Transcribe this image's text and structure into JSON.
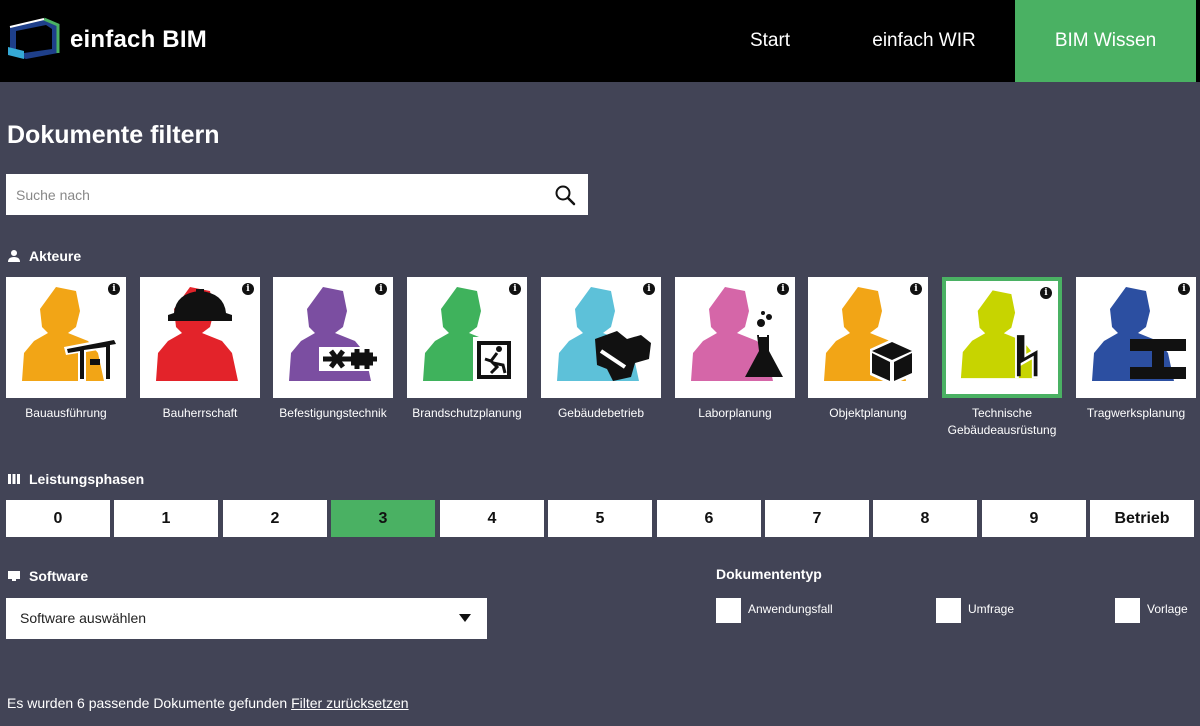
{
  "header": {
    "brand": "einfach BIM",
    "nav": [
      {
        "label": "Start"
      },
      {
        "label": "einfach WIR"
      },
      {
        "label": "BIM Wissen",
        "active": true
      }
    ]
  },
  "page_title": "Dokumente filtern",
  "search": {
    "placeholder": "Suche nach",
    "value": ""
  },
  "actors": {
    "heading": "Akteure",
    "items": [
      {
        "label": "Bauausführung",
        "color": "#f2a516",
        "icon": "crane-icon"
      },
      {
        "label": "Bauherrschaft",
        "color": "#e3232a",
        "icon": "hardhat-icon"
      },
      {
        "label": "Befestigungstechnik",
        "color": "#7b4ea1",
        "icon": "fastener-icon"
      },
      {
        "label": "Brandschutzplanung",
        "color": "#3fb25c",
        "icon": "emergency-exit-icon"
      },
      {
        "label": "Gebäudebetrieb",
        "color": "#5dc1d9",
        "icon": "wrench-icon"
      },
      {
        "label": "Laborplanung",
        "color": "#d566a8",
        "icon": "flask-icon"
      },
      {
        "label": "Objektplanung",
        "color": "#f2a516",
        "icon": "cube-icon"
      },
      {
        "label": "Technische Gebäudeausrüstung",
        "color": "#c7d400",
        "icon": "lightning-icon",
        "selected": true
      },
      {
        "label": "Tragwerksplanung",
        "color": "#2c4fa1",
        "icon": "i-beam-icon"
      }
    ]
  },
  "phases": {
    "heading": "Leistungsphasen",
    "items": [
      "0",
      "1",
      "2",
      "3",
      "4",
      "5",
      "6",
      "7",
      "8",
      "9",
      "Betrieb"
    ],
    "active": "3"
  },
  "software": {
    "heading": "Software",
    "selected": "Software auswählen"
  },
  "doctype": {
    "heading": "Dokumententyp",
    "options": [
      {
        "label": "Anwendungsfall",
        "checked": false
      },
      {
        "label": "Umfrage",
        "checked": false
      },
      {
        "label": "Vorlage",
        "checked": false
      }
    ]
  },
  "result": {
    "text": "Es wurden 6 passende Dokumente gefunden",
    "reset_link": "Filter zurücksetzen"
  },
  "colors": {
    "background": "#424456",
    "header": "#000000",
    "accent": "#4ab163"
  }
}
